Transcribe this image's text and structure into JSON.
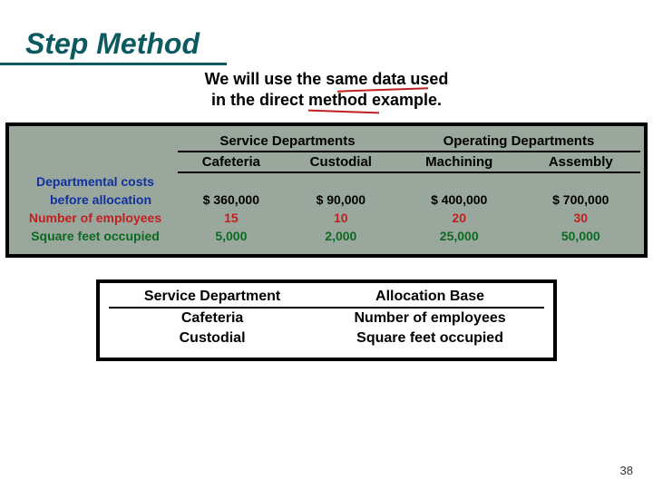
{
  "title": "Step Method",
  "subtitle_line1": "We will use the same data used",
  "subtitle_line2": "in the direct method example.",
  "page_number": "38",
  "main_table": {
    "group_headers": [
      "Service Departments",
      "Operating Departments"
    ],
    "col_headers": [
      "Cafeteria",
      "Custodial",
      "Machining",
      "Assembly"
    ],
    "rows": [
      {
        "label_line1": "Departmental costs",
        "label_line2": "before allocation",
        "color": "blue",
        "value_color": "black",
        "values": [
          "$ 360,000",
          "$  90,000",
          "$ 400,000",
          "$ 700,000"
        ]
      },
      {
        "label_line1": "Number of employees",
        "label_line2": "",
        "color": "red",
        "value_color": "red",
        "values": [
          "15",
          "10",
          "20",
          "30"
        ]
      },
      {
        "label_line1": "Square feet occupied",
        "label_line2": "",
        "color": "green",
        "value_color": "green",
        "values": [
          "5,000",
          "2,000",
          "25,000",
          "50,000"
        ]
      }
    ]
  },
  "alloc_table": {
    "headers": [
      "Service Department",
      "Allocation Base"
    ],
    "rows": [
      [
        "Cafeteria",
        "Number of employees"
      ],
      [
        "Custodial",
        "Square feet occupied"
      ]
    ]
  }
}
